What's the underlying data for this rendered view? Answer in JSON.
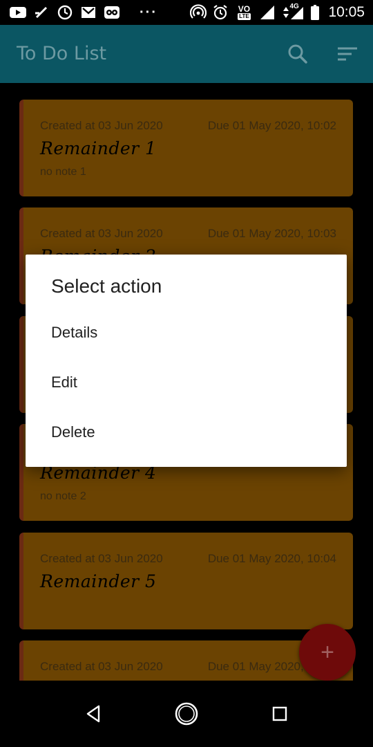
{
  "status_bar": {
    "time": "10:05",
    "dots": "···",
    "network_label": "4G",
    "volte_label": "VO",
    "lte_label": "LTE"
  },
  "app_bar": {
    "title": "To Do List"
  },
  "cards": [
    {
      "created": "Created at 03 Jun 2020",
      "due": "Due 01 May 2020, 10:02",
      "title": "Remainder 1",
      "note": "no note 1"
    },
    {
      "created": "Created at 03 Jun 2020",
      "due": "Due 01 May 2020, 10:03",
      "title": "Remainder 2",
      "note": ""
    },
    {
      "created": "",
      "due": "",
      "title": "",
      "note": ""
    },
    {
      "created": "",
      "due": "",
      "title": "Remainder 4",
      "note": "no note 2"
    },
    {
      "created": "Created at 03 Jun 2020",
      "due": "Due 01 May 2020, 10:04",
      "title": "Remainder 5",
      "note": ""
    },
    {
      "created": "Created at 03 Jun 2020",
      "due": "Due 01 May 2020, 10:05",
      "title": "",
      "note": ""
    }
  ],
  "dialog": {
    "title": "Select action",
    "items": [
      "Details",
      "Edit",
      "Delete"
    ]
  },
  "fab": {
    "symbol": "+"
  },
  "colors": {
    "app_bar": "#0b5663",
    "card": "#6b4302",
    "card_accent": "#6b2a13",
    "fab": "#6e0a0a"
  }
}
